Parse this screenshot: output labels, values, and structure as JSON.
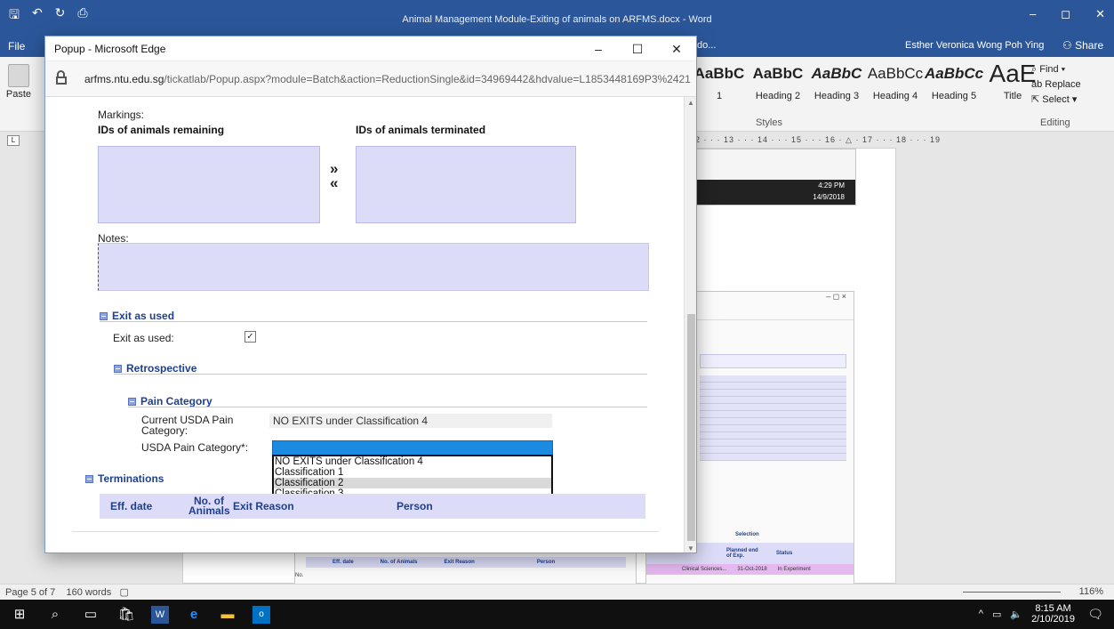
{
  "word": {
    "title": "Animal Management Module-Exiting of animals on ARFMS.docx - Word",
    "file_tab": "File",
    "tell_me": "do...",
    "user": "Esther Veronica Wong Poh Ying",
    "share": "Share",
    "paste": "Paste",
    "styles": [
      {
        "sample": "AaBbC",
        "name": "1"
      },
      {
        "sample": "AaBbC",
        "name": "Heading 2"
      },
      {
        "sample": "AaBbC",
        "name": "Heading 3"
      },
      {
        "sample": "AaBbCc",
        "name": "Heading 4"
      },
      {
        "sample": "AaBbCc",
        "name": "Heading 5"
      },
      {
        "sample": "AaE",
        "name": "Title"
      }
    ],
    "styles_group": "Styles",
    "editing": {
      "find": "Find",
      "replace": "Replace",
      "select": "Select",
      "label": "Editing"
    },
    "ruler_marks": "2 · · · 13 · · · 14 · · · 15 · · · 16 · △ · 17 · · · 18 · · · 19",
    "status": {
      "page": "Page 5 of 7",
      "words": "160 words",
      "zoom": "116%"
    },
    "embedded_window_controls": "–   ◻   ×",
    "embedded": {
      "time": "4:29 PM",
      "date": "14/9/2018",
      "selection": "Selection",
      "planned": "Planned end of Exp.",
      "status": "Status",
      "clinical": "Clinical Sciences...",
      "planned_date": "31-Oct-2018",
      "in_experiment": "In Experiment",
      "eff_date": "Eff. date",
      "no_animals": "No. of Animals",
      "exit_reason": "Exit Reason",
      "person": "Person",
      "no_prefix": "No."
    }
  },
  "taskbar": {
    "time": "8:15 AM",
    "date": "2/10/2019"
  },
  "popup": {
    "window_title": "Popup - Microsoft Edge",
    "url_host": "arfms.ntu.edu.sg",
    "url_path": "/tickatlab/Popup.aspx?module=Batch&action=ReductionSingle&id=34969442&hdvalue=L1853448169P3%2421",
    "markings_label": "Markings:",
    "ids_remaining": "IDs of animals remaining",
    "ids_terminated": "IDs of animals terminated",
    "move_right": "»",
    "move_left": "«",
    "notes_label": "Notes:",
    "exit_as_used_section": "Exit as used",
    "exit_as_used_label": "Exit as used:",
    "exit_as_used_checked": "✓",
    "retrospective_section": "Retrospective",
    "pain_category_section": "Pain Category",
    "current_usda_label": "Current USDA Pain Category:",
    "current_usda_value": "NO EXITS under Classification 4",
    "usda_label": "USDA Pain Category*:",
    "usda_options": [
      "NO EXITS under Classification 4",
      "Classification 1",
      "Classification 2",
      "Classification 3"
    ],
    "usda_highlighted_index": 2,
    "terminations_section": "Terminations",
    "table_headers": {
      "eff_date": "Eff. date",
      "no_animals_1": "No. of",
      "no_animals_2": "Animals",
      "exit_reason": "Exit Reason",
      "person": "Person"
    }
  },
  "colors": {
    "word_blue": "#2b579a",
    "listbox_bg": "#dcdcf8",
    "section_blue": "#1f3f8f",
    "select_blue": "#1a8be0"
  }
}
